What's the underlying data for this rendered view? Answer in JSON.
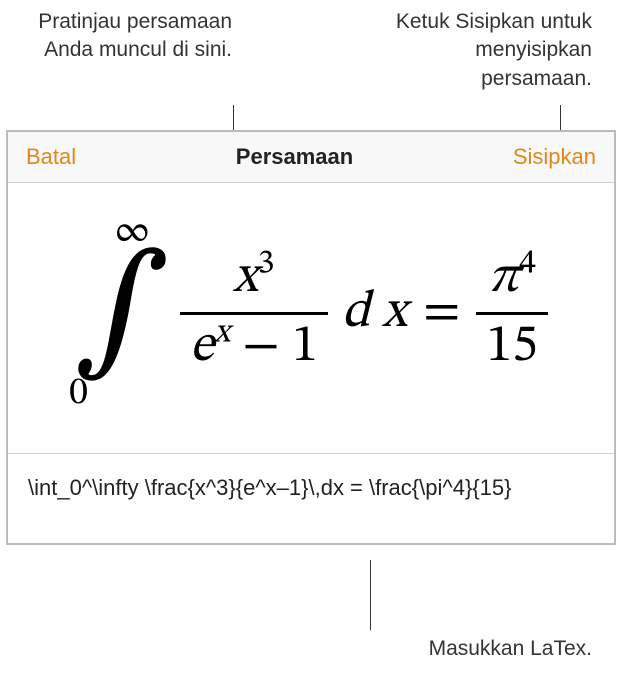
{
  "callouts": {
    "preview": "Pratinjau persamaan Anda muncul di sini.",
    "insert": "Ketuk Sisipkan untuk menyisipkan persamaan.",
    "latex": "Masukkan LaTex."
  },
  "toolbar": {
    "cancel_label": "Batal",
    "title": "Persamaan",
    "insert_label": "Sisipkan"
  },
  "equation": {
    "int_lower": "0",
    "int_upper": "∞",
    "frac1_num_base": "x",
    "frac1_num_sup": "3",
    "frac1_den_base": "e",
    "frac1_den_sup": "x",
    "frac1_den_rest": "− 1",
    "dx": "d x",
    "equals": "=",
    "frac2_num_base": "π",
    "frac2_num_sup": "4",
    "frac2_den": "15"
  },
  "latex_input": "\\int_0^\\infty \\frac{x^3}{e^x–1}\\,dx = \\frac{\\pi^4}{15}"
}
